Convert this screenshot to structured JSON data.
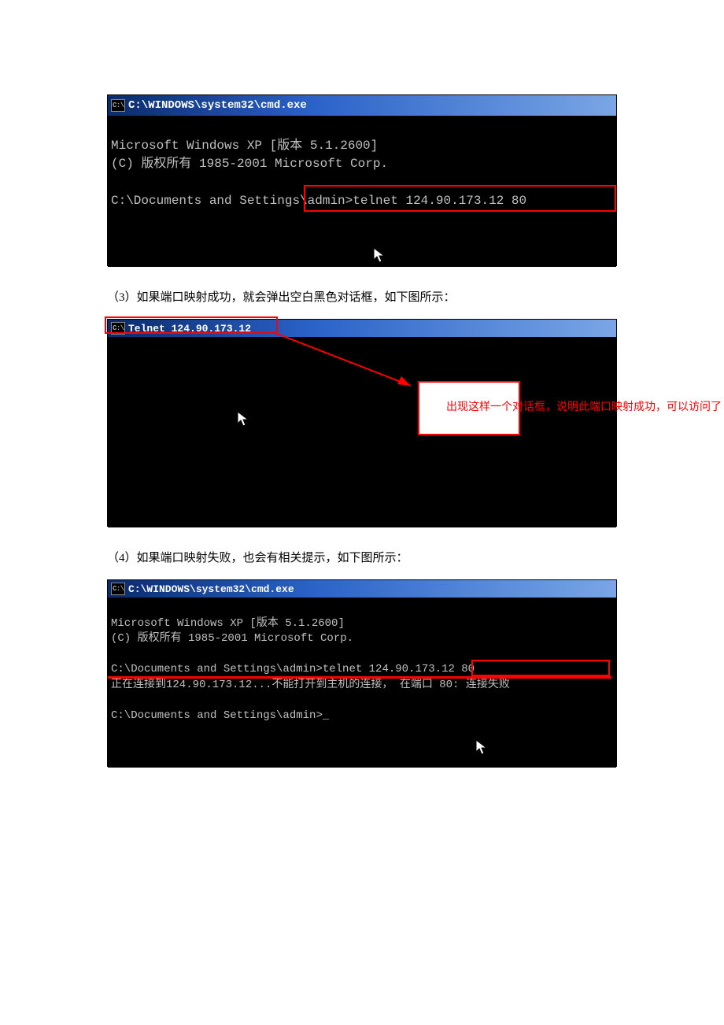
{
  "screenshot1": {
    "title": "C:\\WINDOWS\\system32\\cmd.exe",
    "line1": "Microsoft Windows XP [版本 5.1.2600]",
    "line2": "(C) 版权所有 1985-2001 Microsoft Corp.",
    "prompt": "C:\\Documents and Settings\\admin>",
    "cmd": "telnet 124.90.173.12 80"
  },
  "caption3": "（3）如果端口映射成功，就会弹出空白黑色对话框，如下图所示：",
  "screenshot2": {
    "title": "Telnet 124.90.173.12",
    "callout": "出现这样一个对话框，说明此端口映射成功，可以访问了 。"
  },
  "caption4": "（4）如果端口映射失败，也会有相关提示，如下图所示：",
  "screenshot3": {
    "title": "C:\\WINDOWS\\system32\\cmd.exe",
    "line1": "Microsoft Windows XP [版本 5.1.2600]",
    "line2": "(C) 版权所有 1985-2001 Microsoft Corp.",
    "prompt1": "C:\\Documents and Settings\\admin>",
    "cmd1": "telnet 124.90.173.12 80",
    "err_pre": "正在连接到124.90.173.12...不能打开到主机的连接， ",
    "err_hl": "在端口 80: 连接失败",
    "prompt2": "C:\\Documents and Settings\\admin>",
    "cursor_char": "_"
  }
}
